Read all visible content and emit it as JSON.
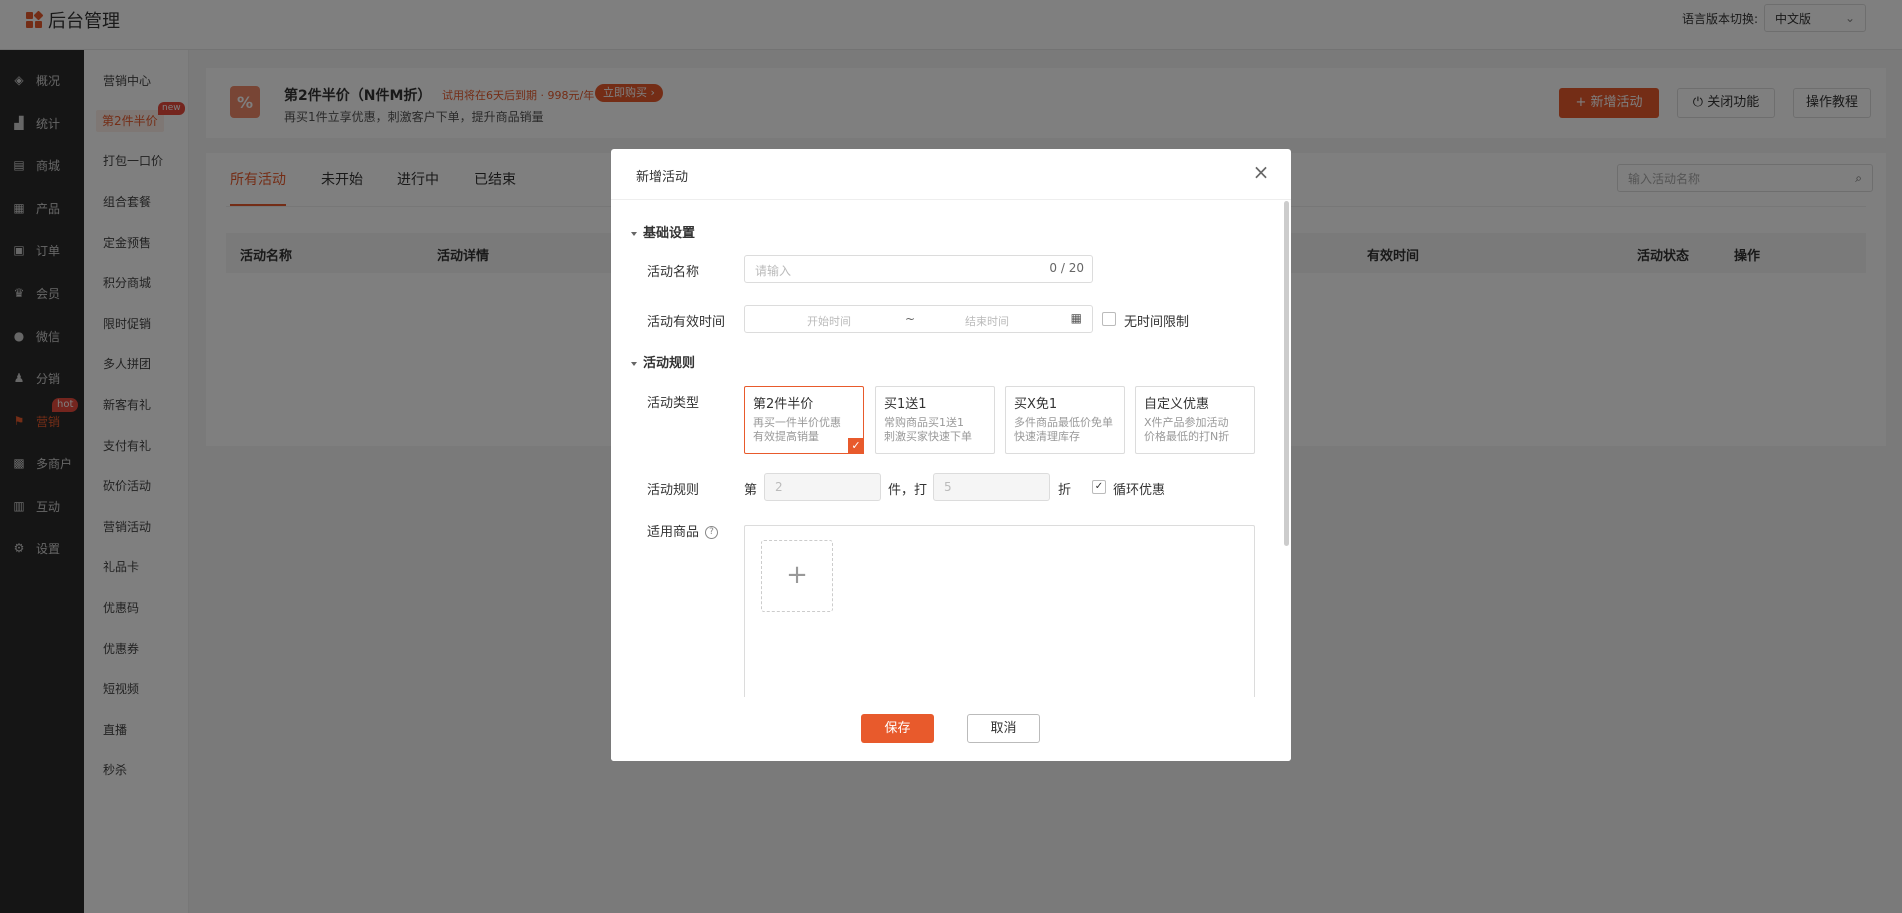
{
  "header": {
    "logo_text": "后台管理",
    "lang_label": "语言版本切换:",
    "lang_value": "中文版"
  },
  "sidebar": {
    "items": [
      {
        "label": "概况",
        "icon": "layers-icon"
      },
      {
        "label": "统计",
        "icon": "chart-icon"
      },
      {
        "label": "商城",
        "icon": "store-icon"
      },
      {
        "label": "产品",
        "icon": "grid-icon"
      },
      {
        "label": "订单",
        "icon": "order-icon"
      },
      {
        "label": "会员",
        "icon": "crown-icon"
      },
      {
        "label": "微信",
        "icon": "wechat-icon"
      },
      {
        "label": "分销",
        "icon": "user-share-icon"
      },
      {
        "label": "营销",
        "icon": "flag-icon"
      },
      {
        "label": "多商户",
        "icon": "merchant-icon"
      },
      {
        "label": "互动",
        "icon": "interact-icon"
      },
      {
        "label": "设置",
        "icon": "gear-icon"
      }
    ],
    "hot_badge": "hot"
  },
  "submenu": {
    "items": [
      "营销中心",
      "第2件半价",
      "打包一口价",
      "组合套餐",
      "定金预售",
      "积分商城",
      "限时促销",
      "多人拼团",
      "新客有礼",
      "支付有礼",
      "砍价活动",
      "营销活动",
      "礼品卡",
      "优惠码",
      "优惠券",
      "短视频",
      "直播",
      "秒杀"
    ],
    "new_badge": "new"
  },
  "promo": {
    "icon_text": "%",
    "title": "第2件半价（N件M折）",
    "trial": "试用将在6天后到期 · 998元/年",
    "buy_label": "立即购买 ›",
    "desc": "再买1件立享优惠，刺激客户下单，提升商品销量",
    "add_label": "+ 新增活动",
    "close_label": "⏻ 关闭功能",
    "tutorial_label": "操作教程"
  },
  "tabs": [
    "所有活动",
    "未开始",
    "进行中",
    "已结束"
  ],
  "search": {
    "placeholder": "输入活动名称"
  },
  "table": {
    "headers": [
      "活动名称",
      "活动详情",
      "有效时间",
      "活动状态",
      "操作"
    ]
  },
  "modal": {
    "title": "新增活动",
    "section_basic": "基础设置",
    "name_label": "活动名称",
    "name_placeholder": "请输入",
    "name_count": "0 / 20",
    "time_label": "活动有效时间",
    "start_placeholder": "开始时间",
    "range_sep": "~",
    "end_placeholder": "结束时间",
    "no_limit_label": "无时间限制",
    "section_rules": "活动规则",
    "type_label": "活动类型",
    "types": [
      {
        "name": "第2件半价",
        "desc1": "再买一件半价优惠",
        "desc2": "有效提高销量",
        "selected": true
      },
      {
        "name": "买1送1",
        "desc1": "常购商品买1送1",
        "desc2": "刺激买家快速下单",
        "selected": false
      },
      {
        "name": "买X免1",
        "desc1": "多件商品最低价免单",
        "desc2": "快速清理库存",
        "selected": false
      },
      {
        "name": "自定义优惠",
        "desc1": "X件产品参加活动",
        "desc2": "价格最低的打N折",
        "selected": false
      }
    ],
    "rule_label": "活动规则",
    "rule_prefix": "第",
    "rule_piece_value": "2",
    "rule_mid": "件，打",
    "rule_discount_value": "5",
    "rule_suffix": "折",
    "loop_label": "循环优惠",
    "goods_label": "适用商品",
    "save_label": "保存",
    "cancel_label": "取消"
  },
  "colors": {
    "accent": "#e85a2c",
    "sidebar_bg": "#2b2b2b"
  }
}
